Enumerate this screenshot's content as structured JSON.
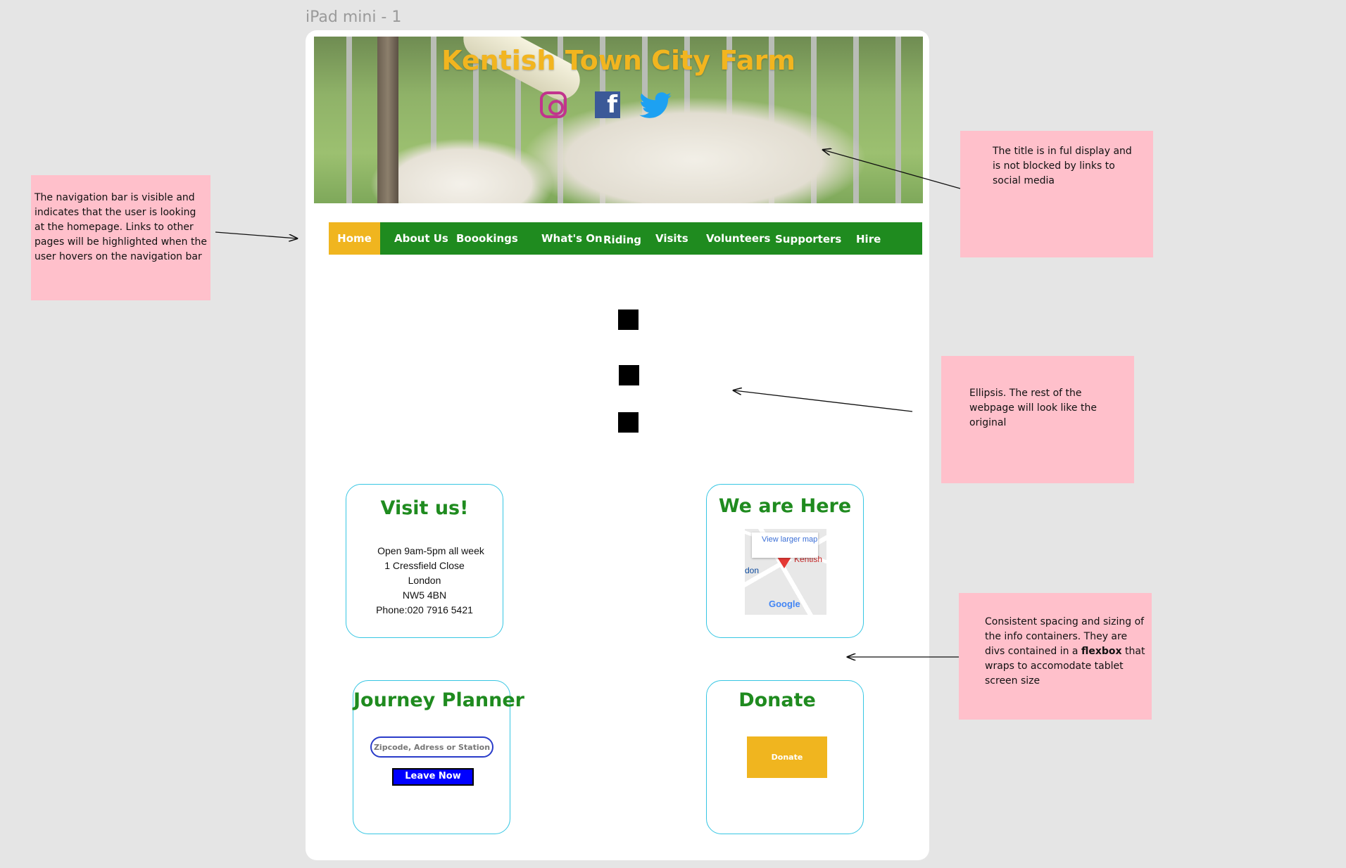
{
  "frame_label": "iPad mini - 1",
  "hero": {
    "title": "Kentish Town City Farm",
    "social_icons": [
      "instagram-icon",
      "facebook-icon",
      "twitter-icon"
    ]
  },
  "nav": {
    "items": [
      "Home",
      "About Us",
      "Boookings",
      "What's On",
      "Riding",
      "Visits",
      "Volunteers",
      "Supporters",
      "Hire"
    ],
    "active": "Home"
  },
  "cards": {
    "visit": {
      "title": "Visit us!",
      "lines": [
        "Open 9am-5pm all week",
        "1 Cressfield Close",
        "London",
        "NW5 4BN",
        "Phone:020 7916 5421"
      ]
    },
    "location": {
      "title": "We are Here",
      "map_link": "View larger map",
      "map_place": "Kentish",
      "map_side_label": "don",
      "map_brand": "Google"
    },
    "journey": {
      "title": "Journey Planner",
      "placeholder": "Zipcode, Adress or Station",
      "button": "Leave Now"
    },
    "donate": {
      "title": "Donate",
      "button": "Donate"
    }
  },
  "notes": {
    "nav": "The navigation bar is visible and indicates that the user is looking at the homepage. Links to other pages will be highlighted when the user hovers on the navigation bar",
    "title": "The title is in ful display and is not blocked by links to social media",
    "ellipsis": "Ellipsis. The rest of the webpage will look like the original",
    "spacing_before": "Consistent spacing and sizing of the info containers. They are divs contained in a ",
    "spacing_bold": "flexbox",
    "spacing_after": " that wraps to accomodate tablet screen size"
  },
  "colors": {
    "nav_green": "#1f8b1f",
    "accent_yellow": "#f0b51f",
    "card_border": "#36c6e3",
    "note_pink": "#ffc0cb",
    "button_blue": "#0000ff"
  }
}
